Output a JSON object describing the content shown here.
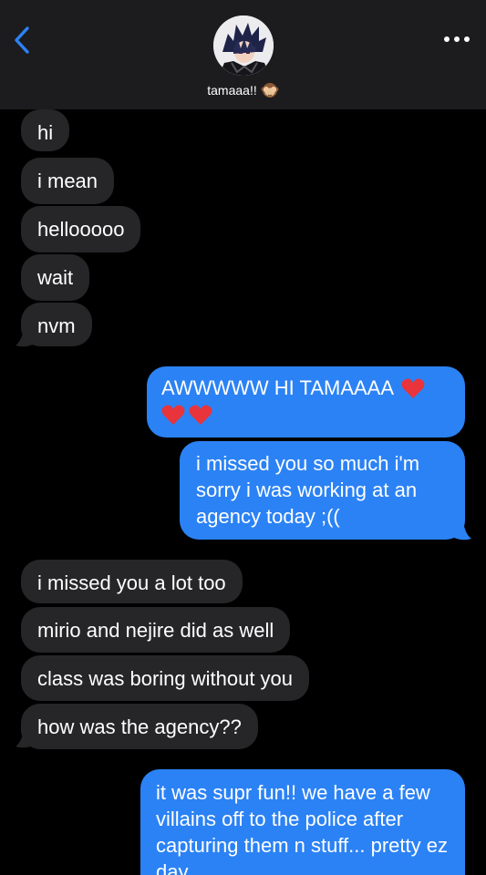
{
  "header": {
    "contact_name": "tamaaa!!",
    "name_emoji": "see-no-evil-monkey-icon",
    "back_icon": "chevron-left-icon",
    "more_icon": "more-options-icon",
    "accent": "#2b82f5"
  },
  "thread": {
    "incoming_bg": "#262628",
    "outgoing_bg": "#2b82f5",
    "messages": [
      {
        "from": "them",
        "text": "hi"
      },
      {
        "from": "them",
        "text": "i mean"
      },
      {
        "from": "them",
        "text": "hellooooo"
      },
      {
        "from": "them",
        "text": "wait"
      },
      {
        "from": "them",
        "text": "nvm"
      },
      {
        "from": "me",
        "line1": "AWWWWW HI TAMAAAA",
        "hearts": "heart-icons"
      },
      {
        "from": "me",
        "text": "i missed you so much i'm sorry i was working at an agency today ;(("
      },
      {
        "from": "them",
        "text": "i missed you a lot too"
      },
      {
        "from": "them",
        "text": "mirio and nejire did as well"
      },
      {
        "from": "them",
        "text": "class was boring without you"
      },
      {
        "from": "them",
        "text": "how was the agency??"
      },
      {
        "from": "me",
        "text": "it was supr fun!! we have a few villains off to the police after capturing them n stuff... pretty ez day"
      }
    ]
  }
}
